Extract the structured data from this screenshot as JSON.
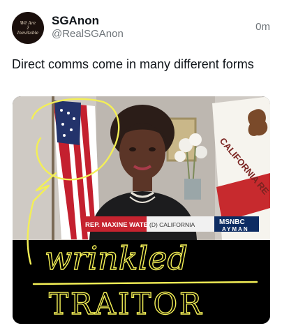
{
  "post": {
    "author": {
      "display_name": "SGAnon",
      "handle": "@RealSGAnon",
      "avatar_text": [
        "Wē Are",
        "ž",
        "Inevitable"
      ]
    },
    "timestamp": "0m",
    "text": "Direct comms come in many different forms",
    "media": {
      "chyron": {
        "name": "REP. MAXINE WATERS",
        "party_state": "(D) CALIFORNIA",
        "network": "MSNBC",
        "show": "AYMAN"
      },
      "flag_text": "CALIFORNIA RE",
      "handwriting": {
        "word1": "wrinkled",
        "word2": "TRAITOR"
      }
    }
  }
}
